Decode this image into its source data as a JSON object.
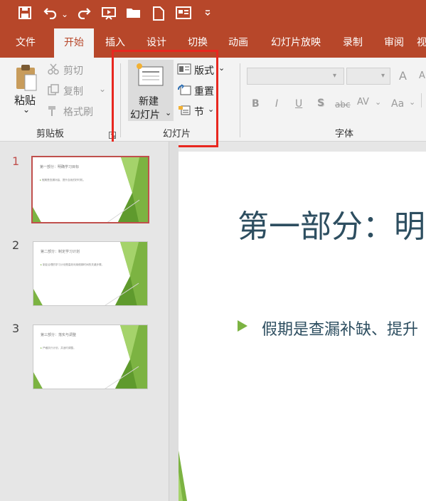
{
  "quick_access": {
    "icons": [
      "save-icon",
      "undo-icon",
      "redo-icon",
      "present-icon",
      "open-folder-icon",
      "new-file-icon",
      "picture-icon",
      "customize-icon"
    ],
    "chevron": "⌄"
  },
  "tabs": [
    {
      "label": "文件",
      "active": false
    },
    {
      "label": "开始",
      "active": true
    },
    {
      "label": "插入",
      "active": false
    },
    {
      "label": "设计",
      "active": false
    },
    {
      "label": "切换",
      "active": false
    },
    {
      "label": "动画",
      "active": false
    },
    {
      "label": "幻灯片放映",
      "active": false
    },
    {
      "label": "录制",
      "active": false
    },
    {
      "label": "审阅",
      "active": false
    },
    {
      "label": "视",
      "active": false
    }
  ],
  "ribbon": {
    "clipboard": {
      "paste": "粘贴",
      "cut": "剪切",
      "copy": "复制",
      "format_painter": "格式刷",
      "group_label": "剪贴板"
    },
    "slides": {
      "new_slide_line1": "新建",
      "new_slide_line2": "幻灯片",
      "layout": "版式",
      "reset": "重置",
      "section": "节",
      "group_label": "幻灯片"
    },
    "font": {
      "group_label": "字体",
      "bold": "B",
      "italic": "I",
      "underline": "U",
      "shadow": "S",
      "strike": "abc",
      "spacing": "AV",
      "case": "Aa",
      "grow": "A",
      "shrink": "A"
    }
  },
  "slides": [
    {
      "number": "1",
      "title": "第一部分：明确学习目标",
      "bullet": "假期是查漏补缺、提升自我的好时机。",
      "selected": true
    },
    {
      "number": "2",
      "title": "第二部分：制定学习计划",
      "bullet": "制定合理的学习计划是高效利用假期时间的关键步骤。",
      "selected": false
    },
    {
      "number": "3",
      "title": "第三部分：落实与调整",
      "bullet": "严格执行计划，并适时调整。",
      "selected": false
    }
  ],
  "main_slide": {
    "title": "第一部分：明",
    "bullet": "假期是查漏补缺、提升"
  },
  "colors": {
    "brand": "#b7472a",
    "accent_green": "#7cb342",
    "highlight": "#e8271f",
    "title_text": "#2d4e60"
  }
}
